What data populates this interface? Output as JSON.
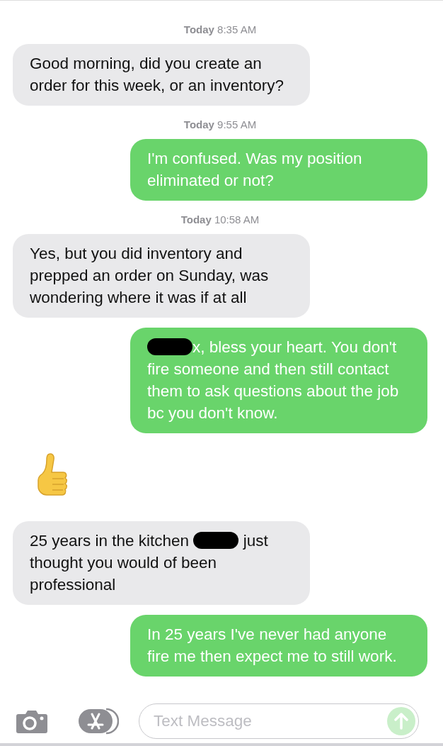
{
  "thread": [
    {
      "kind": "timestamp",
      "day": "Today",
      "time": "8:35 AM"
    },
    {
      "kind": "message",
      "sent": false,
      "segments": [
        {
          "kind": "text",
          "text": "Good morning, did you create an order for this week, or an inventory?"
        }
      ]
    },
    {
      "kind": "timestamp",
      "day": "Today",
      "time": "9:55 AM"
    },
    {
      "kind": "message",
      "sent": true,
      "segments": [
        {
          "kind": "text",
          "text": "I'm confused. Was my position eliminated or not?"
        }
      ]
    },
    {
      "kind": "timestamp",
      "day": "Today",
      "time": "10:58 AM"
    },
    {
      "kind": "message",
      "sent": false,
      "segments": [
        {
          "kind": "text",
          "text": "Yes, but you did inventory and prepped an order on Sunday, was wondering where it was if at all"
        }
      ]
    },
    {
      "kind": "message",
      "sent": true,
      "segments": [
        {
          "kind": "redaction"
        },
        {
          "kind": "text",
          "text": "x, bless your heart. You don't fire someone and then still contact them to ask questions about the job bc you don't know."
        }
      ]
    },
    {
      "kind": "reaction",
      "sent": false
    },
    {
      "kind": "message",
      "sent": false,
      "segments": [
        {
          "kind": "text",
          "text": "25 years in the kitchen "
        },
        {
          "kind": "redaction"
        },
        {
          "kind": "text",
          "text": " just thought you would of been professional"
        }
      ]
    },
    {
      "kind": "message",
      "sent": true,
      "segments": [
        {
          "kind": "text",
          "text": "In 25 years I've never had anyone fire me then expect me to still work."
        }
      ]
    }
  ],
  "composer": {
    "placeholder": "Text Message"
  }
}
